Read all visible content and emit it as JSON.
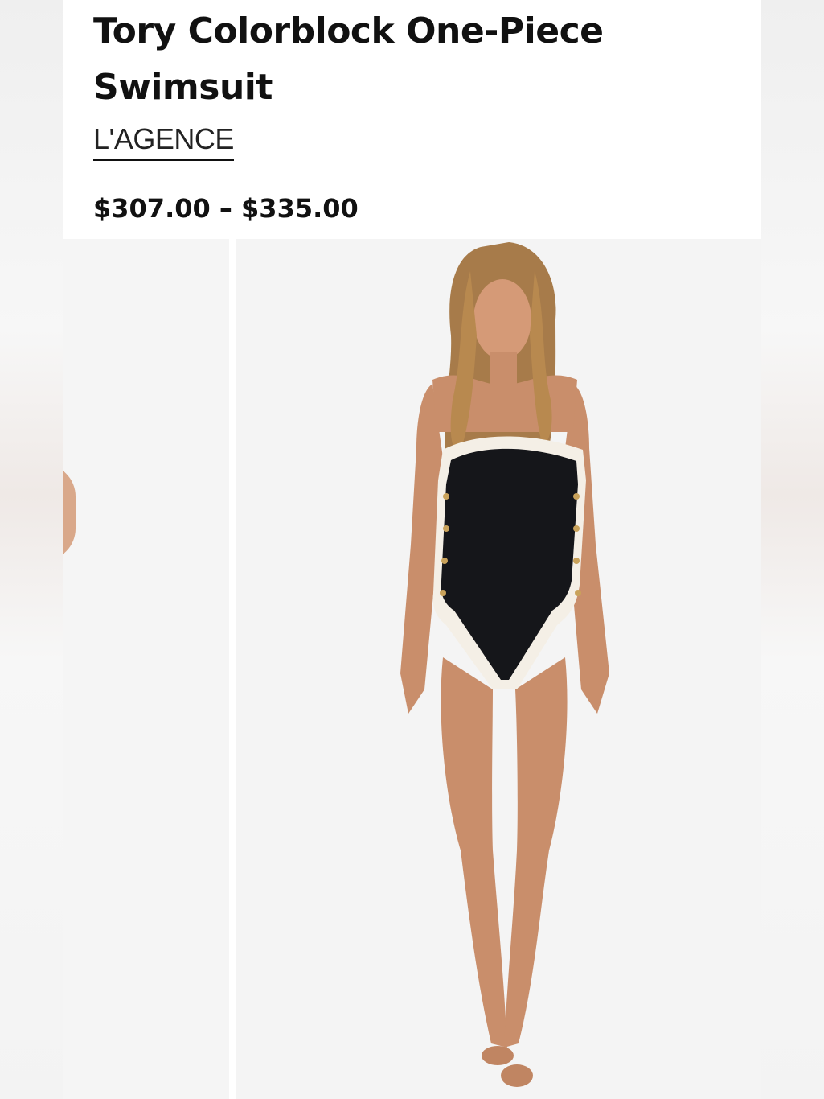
{
  "product": {
    "title": "Tory Colorblock One-Piece Swimsuit",
    "brand": "L'AGENCE",
    "price_range": "$307.00 – $335.00"
  },
  "gallery": {
    "images": [
      {
        "description_name": "previous-product-image"
      },
      {
        "description_name": "main-product-image"
      }
    ]
  },
  "colors": {
    "swimsuit": "#15161a",
    "trim": "#f4efe6",
    "skin": "#c98e6b",
    "hair": "#a77b4a"
  }
}
